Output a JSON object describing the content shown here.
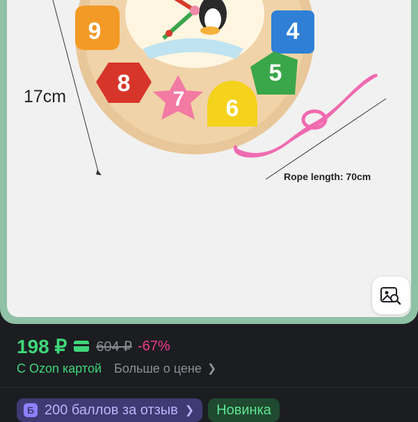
{
  "product_image": {
    "size_label": "17cm",
    "rope_label": "Rope length: 70cm",
    "clock_numbers": [
      "9",
      "4",
      "8",
      "5",
      "7",
      "6"
    ]
  },
  "image_search": {
    "icon": "image-search-icon"
  },
  "price": {
    "current": "198 ₽",
    "old": "604 ₽",
    "discount": "-67%",
    "card_note": "С Ozon картой",
    "more_link": "Больше о цене",
    "accent": "#3fd67a",
    "discount_color": "#f23b8c"
  },
  "badges": {
    "points_icon_letter": "Б",
    "points_label": "200 баллов за отзыв",
    "new_label": "Новинка"
  }
}
